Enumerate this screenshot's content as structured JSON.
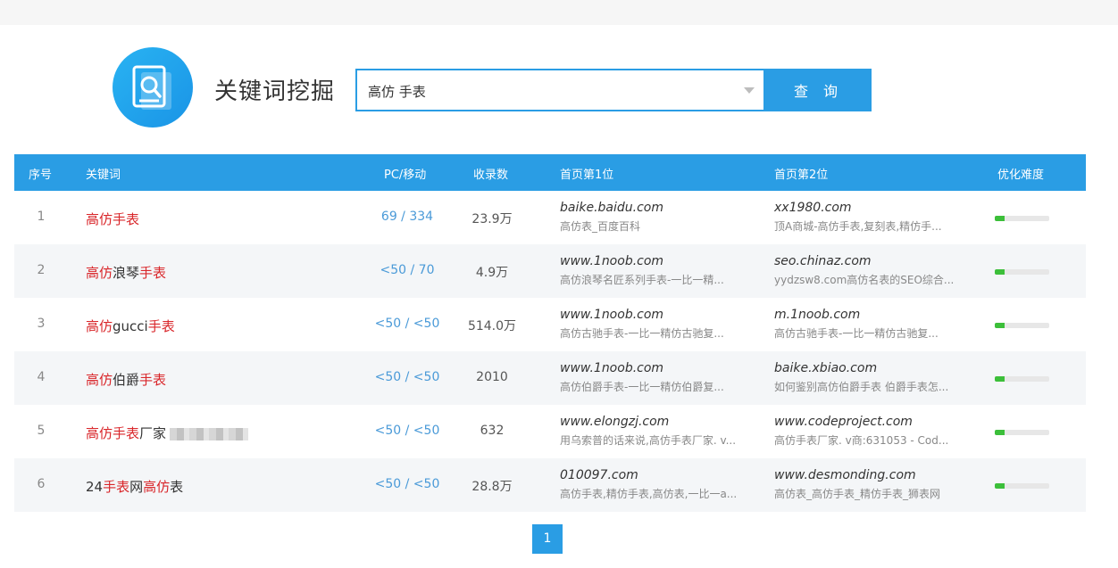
{
  "header": {
    "title": "关键词挖掘",
    "search_value": "高仿 手表",
    "search_button": "查 询"
  },
  "table": {
    "columns": [
      "序号",
      "关键词",
      "PC/移动",
      "收录数",
      "首页第1位",
      "首页第2位",
      "优化难度"
    ],
    "rows": [
      {
        "no": "1",
        "keyword_parts": [
          {
            "t": "高仿手表",
            "hl": true
          }
        ],
        "pc_mobile": "69 / 334",
        "count": "23.9万",
        "r1_domain": "baike.baidu.com",
        "r1_desc": "高仿表_百度百科",
        "r2_domain": "xx1980.com",
        "r2_desc": "顶A商城-高仿手表,复刻表,精仿手...",
        "difficulty": 0.18
      },
      {
        "no": "2",
        "keyword_parts": [
          {
            "t": "高仿",
            "hl": true
          },
          {
            "t": "浪琴",
            "hl": false
          },
          {
            "t": "手表",
            "hl": true
          }
        ],
        "pc_mobile": "<50 / 70",
        "count": "4.9万",
        "r1_domain": "www.1noob.com",
        "r1_desc": "高仿浪琴名匠系列手表-一比一精...",
        "r2_domain": "seo.chinaz.com",
        "r2_desc": "yydzsw8.com高仿名表的SEO综合...",
        "difficulty": 0.18
      },
      {
        "no": "3",
        "keyword_parts": [
          {
            "t": "高仿",
            "hl": true
          },
          {
            "t": "gucci",
            "hl": false
          },
          {
            "t": "手表",
            "hl": true
          }
        ],
        "pc_mobile": "<50 / <50",
        "count": "514.0万",
        "r1_domain": "www.1noob.com",
        "r1_desc": "高仿古驰手表-一比一精仿古驰复...",
        "r2_domain": "m.1noob.com",
        "r2_desc": "高仿古驰手表-一比一精仿古驰复...",
        "difficulty": 0.18
      },
      {
        "no": "4",
        "keyword_parts": [
          {
            "t": "高仿",
            "hl": true
          },
          {
            "t": "伯爵",
            "hl": false
          },
          {
            "t": "手表",
            "hl": true
          }
        ],
        "pc_mobile": "<50 / <50",
        "count": "2010",
        "r1_domain": "www.1noob.com",
        "r1_desc": "高仿伯爵手表-一比一精仿伯爵复...",
        "r2_domain": "baike.xbiao.com",
        "r2_desc": "如何鉴别高仿伯爵手表 伯爵手表怎...",
        "difficulty": 0.18
      },
      {
        "no": "5",
        "keyword_parts": [
          {
            "t": "高仿手表",
            "hl": true
          },
          {
            "t": "厂家",
            "hl": false
          }
        ],
        "blurred": true,
        "pc_mobile": "<50 / <50",
        "count": "632",
        "r1_domain": "www.elongzj.com",
        "r1_desc": "用乌索普的话来说,高仿手表厂家. v...",
        "r2_domain": "www.codeproject.com",
        "r2_desc": "高仿手表厂家. v商:631053 - Cod...",
        "difficulty": 0.18
      },
      {
        "no": "6",
        "keyword_parts": [
          {
            "t": "24",
            "hl": false
          },
          {
            "t": "手表",
            "hl": true
          },
          {
            "t": "网",
            "hl": false
          },
          {
            "t": "高仿",
            "hl": true
          },
          {
            "t": "表",
            "hl": false
          }
        ],
        "pc_mobile": "<50 / <50",
        "count": "28.8万",
        "r1_domain": "010097.com",
        "r1_desc": "高仿手表,精仿手表,高仿表,一比一a...",
        "r2_domain": "www.desmonding.com",
        "r2_desc": "高仿表_高仿手表_精仿手表_狮表网",
        "difficulty": 0.18
      }
    ]
  },
  "pager": {
    "current": "1"
  },
  "colors": {
    "accent": "#2a9de4",
    "highlight": "#d9262a",
    "difficulty": "#3cbf3a"
  },
  "icons": {
    "logo": "search-document-icon",
    "dropdown": "caret-down-icon"
  }
}
